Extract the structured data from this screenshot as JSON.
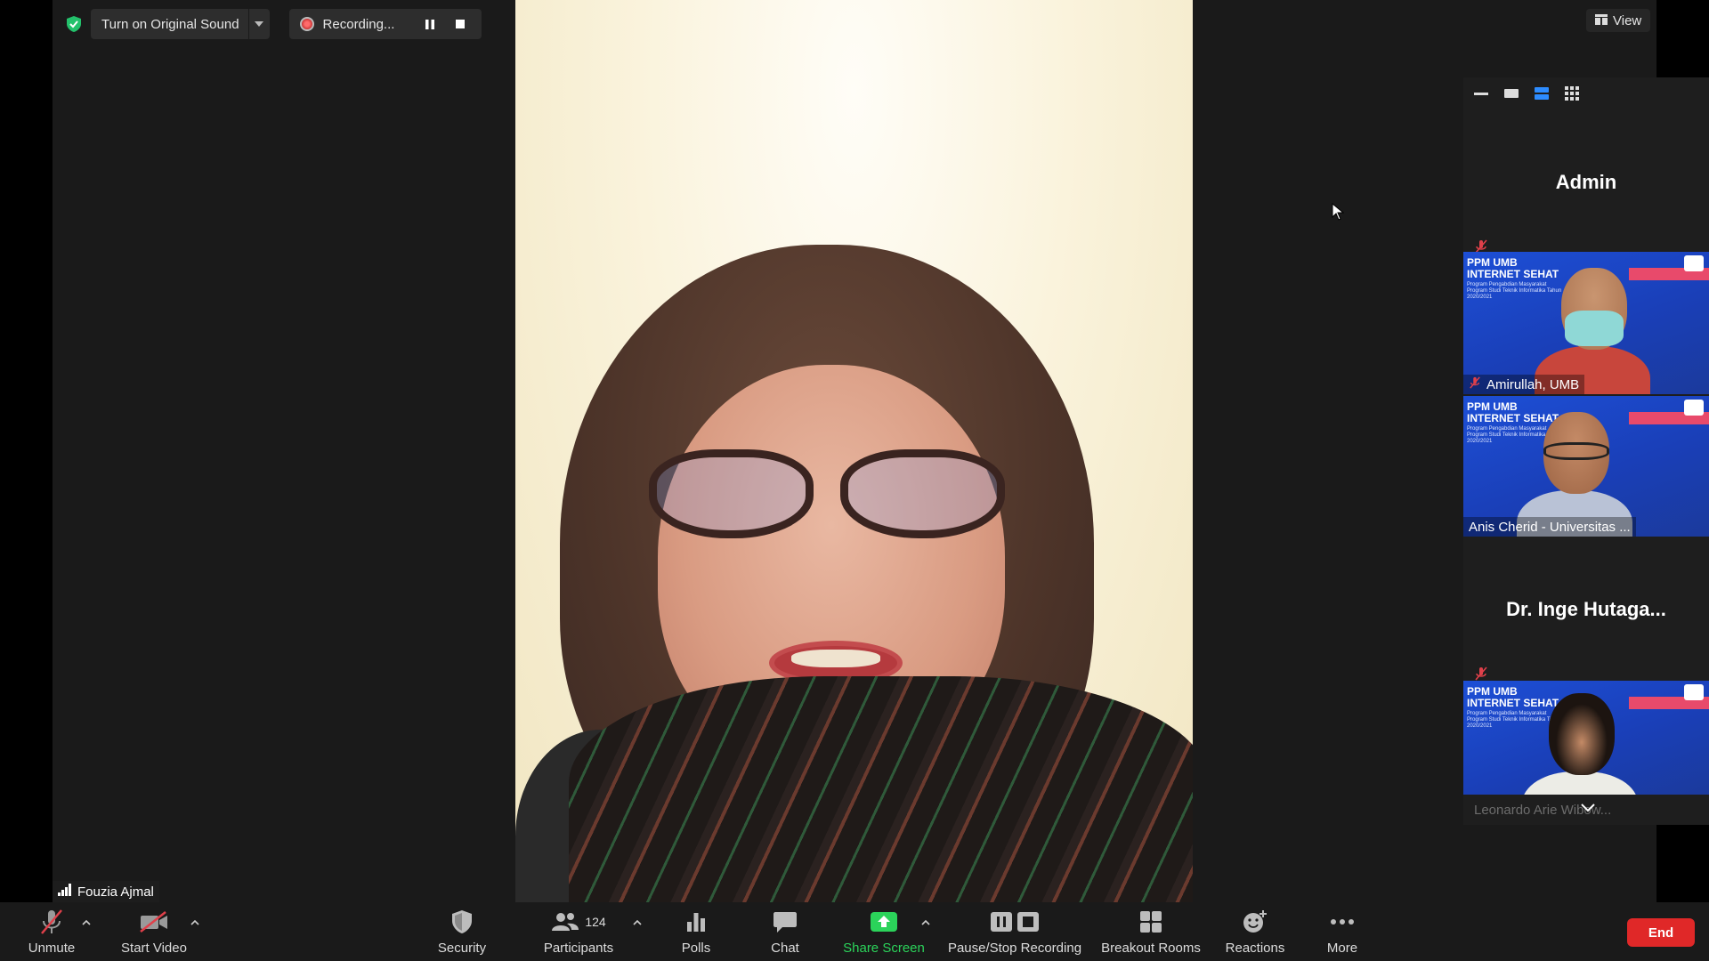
{
  "top_bar": {
    "original_sound_label": "Turn on Original Sound",
    "recording_label": "Recording...",
    "view_label": "View"
  },
  "speaker": {
    "name": "Fouzia Ajmal"
  },
  "gallery": {
    "tiles": [
      {
        "name": "Admin"
      },
      {
        "name": "Amirullah, UMB",
        "slide_title": "PPM UMB\nINTERNET SEHAT"
      },
      {
        "name": "Anis Cherid - Universitas ...",
        "slide_title": "PPM UMB\nINTERNET SEHAT"
      },
      {
        "name": "Dr. Inge Hutaga..."
      },
      {
        "name": "Leonardo Arie Wibow...",
        "slide_title": "PPM UMB\nINTERNET SEHAT"
      }
    ],
    "slide_subtitle": "Program Pengabdian Masyarakat Program Studi Teknik Informatika Tahun 2020/2021"
  },
  "toolbar": {
    "unmute": "Unmute",
    "start_video": "Start Video",
    "security": "Security",
    "participants": "Participants",
    "participants_count": "124",
    "polls": "Polls",
    "chat": "Chat",
    "share_screen": "Share Screen",
    "pause_stop_recording": "Pause/Stop Recording",
    "breakout_rooms": "Breakout Rooms",
    "reactions": "Reactions",
    "more": "More",
    "end": "End"
  },
  "colors": {
    "share_green": "#2bd35a",
    "end_red": "#e02828",
    "mute_red": "#e0404a",
    "active_blue": "#2d8cff"
  }
}
